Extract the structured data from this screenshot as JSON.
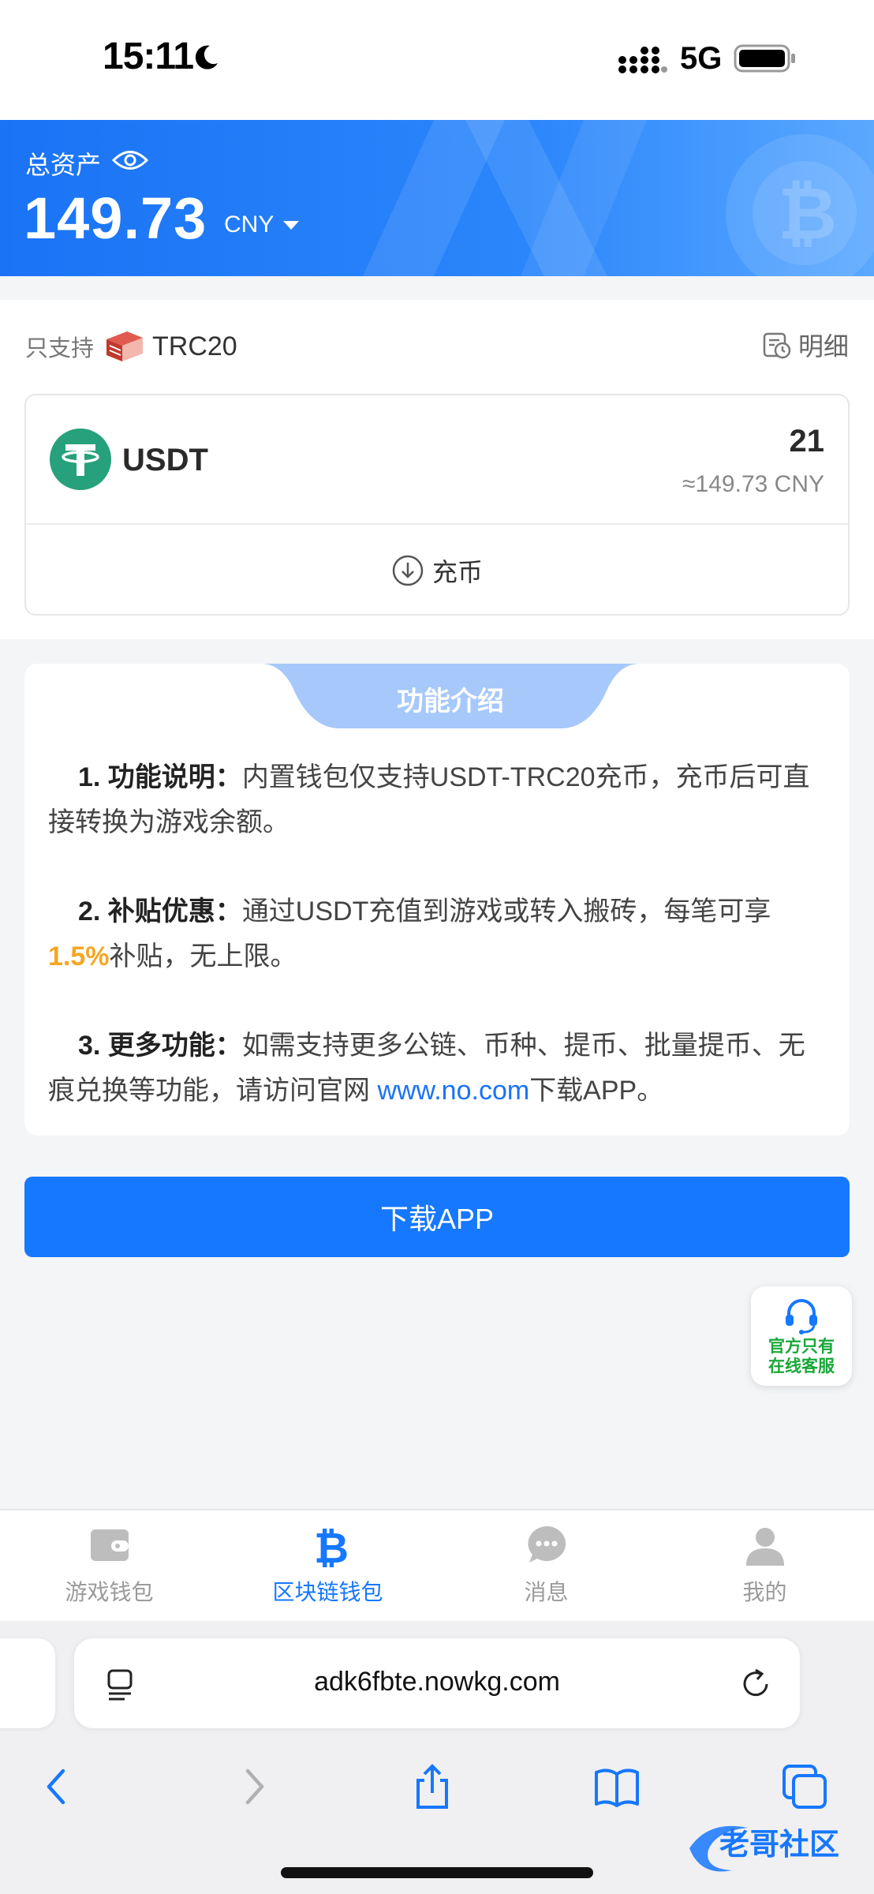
{
  "status_bar": {
    "time": "15:11",
    "network": "5G"
  },
  "header": {
    "assets_label": "总资产",
    "assets_value": "149.73",
    "currency": "CNY"
  },
  "wallet": {
    "support_label": "只支持",
    "chain": "TRC20",
    "detail_label": "明细",
    "coin": {
      "name": "USDT",
      "amount": "21",
      "fiat_value": "≈149.73 CNY"
    },
    "deposit_label": "充币"
  },
  "intro": {
    "title": "功能介绍",
    "items": [
      {
        "lead": "1. 功能说明：",
        "text": "内置钱包仅支持USDT-TRC20充币，充币后可直接转换为游戏余额。"
      },
      {
        "lead": "2. 补贴优惠：",
        "text_before": "通过USDT充值到游戏或转入搬砖，每笔可享",
        "highlight": "1.5%",
        "text_after": "补贴，无上限。"
      },
      {
        "lead": "3. 更多功能：",
        "text_before": "如需支持更多公链、币种、提币、批量提币、无痕兑换等功能，请访问官网 ",
        "link": "www.no.com",
        "text_after": "下载APP。"
      }
    ]
  },
  "download_button": "下载APP",
  "support_float": {
    "line1": "官方只有",
    "line2": "在线客服"
  },
  "tabs": [
    {
      "label": "游戏钱包",
      "icon": "wallet-icon",
      "active": false
    },
    {
      "label": "区块链钱包",
      "icon": "bitcoin-icon",
      "active": true
    },
    {
      "label": "消息",
      "icon": "chat-icon",
      "active": false
    },
    {
      "label": "我的",
      "icon": "user-icon",
      "active": false
    }
  ],
  "browser": {
    "url": "adk6fbte.nowkg.com"
  },
  "colors": {
    "primary": "#1677ff",
    "highlight": "#f5a623",
    "support_green": "#18a838",
    "usdt_green": "#26a17b"
  },
  "watermark": "老哥社区"
}
